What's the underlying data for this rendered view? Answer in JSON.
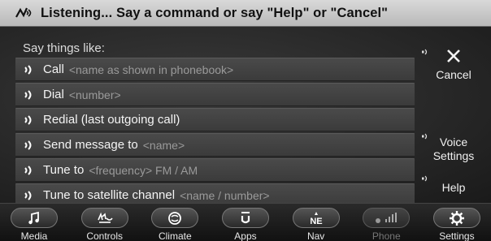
{
  "banner": {
    "text": "Listening... Say a command or say \"Help\" or \"Cancel\"",
    "icon": "voice-recognition-icon"
  },
  "hints": {
    "heading": "Say things like:",
    "commands": [
      {
        "text": "Call",
        "param": "<name as shown in phonebook>"
      },
      {
        "text": "Dial",
        "param": "<number>"
      },
      {
        "text": "Redial (last outgoing call)",
        "param": ""
      },
      {
        "text": "Send message to",
        "param": "<name>"
      },
      {
        "text": "Tune to",
        "param": "<frequency> FM / AM"
      },
      {
        "text": "Tune to satellite channel",
        "param": "<name / number>"
      }
    ]
  },
  "side_buttons": {
    "cancel_label": "Cancel",
    "voice_settings_label_1": "Voice",
    "voice_settings_label_2": "Settings",
    "help_label": "Help"
  },
  "nav": [
    {
      "label": "Media",
      "icon": "music-note-icon"
    },
    {
      "label": "Controls",
      "icon": "controls-icon"
    },
    {
      "label": "Climate",
      "icon": "climate-icon"
    },
    {
      "label": "Apps",
      "icon": "apps-icon"
    },
    {
      "label": "Nav",
      "icon": "compass-icon",
      "glyph": "NE"
    },
    {
      "label": "Phone",
      "icon": "phone-signal-icon",
      "disabled": true
    },
    {
      "label": "Settings",
      "icon": "gear-icon"
    }
  ],
  "colors": {
    "banner_bg": "#c9c9c9",
    "panel_bg": "#2b2b2b",
    "param_text": "#9a9a9a",
    "disabled_text": "#777777"
  }
}
